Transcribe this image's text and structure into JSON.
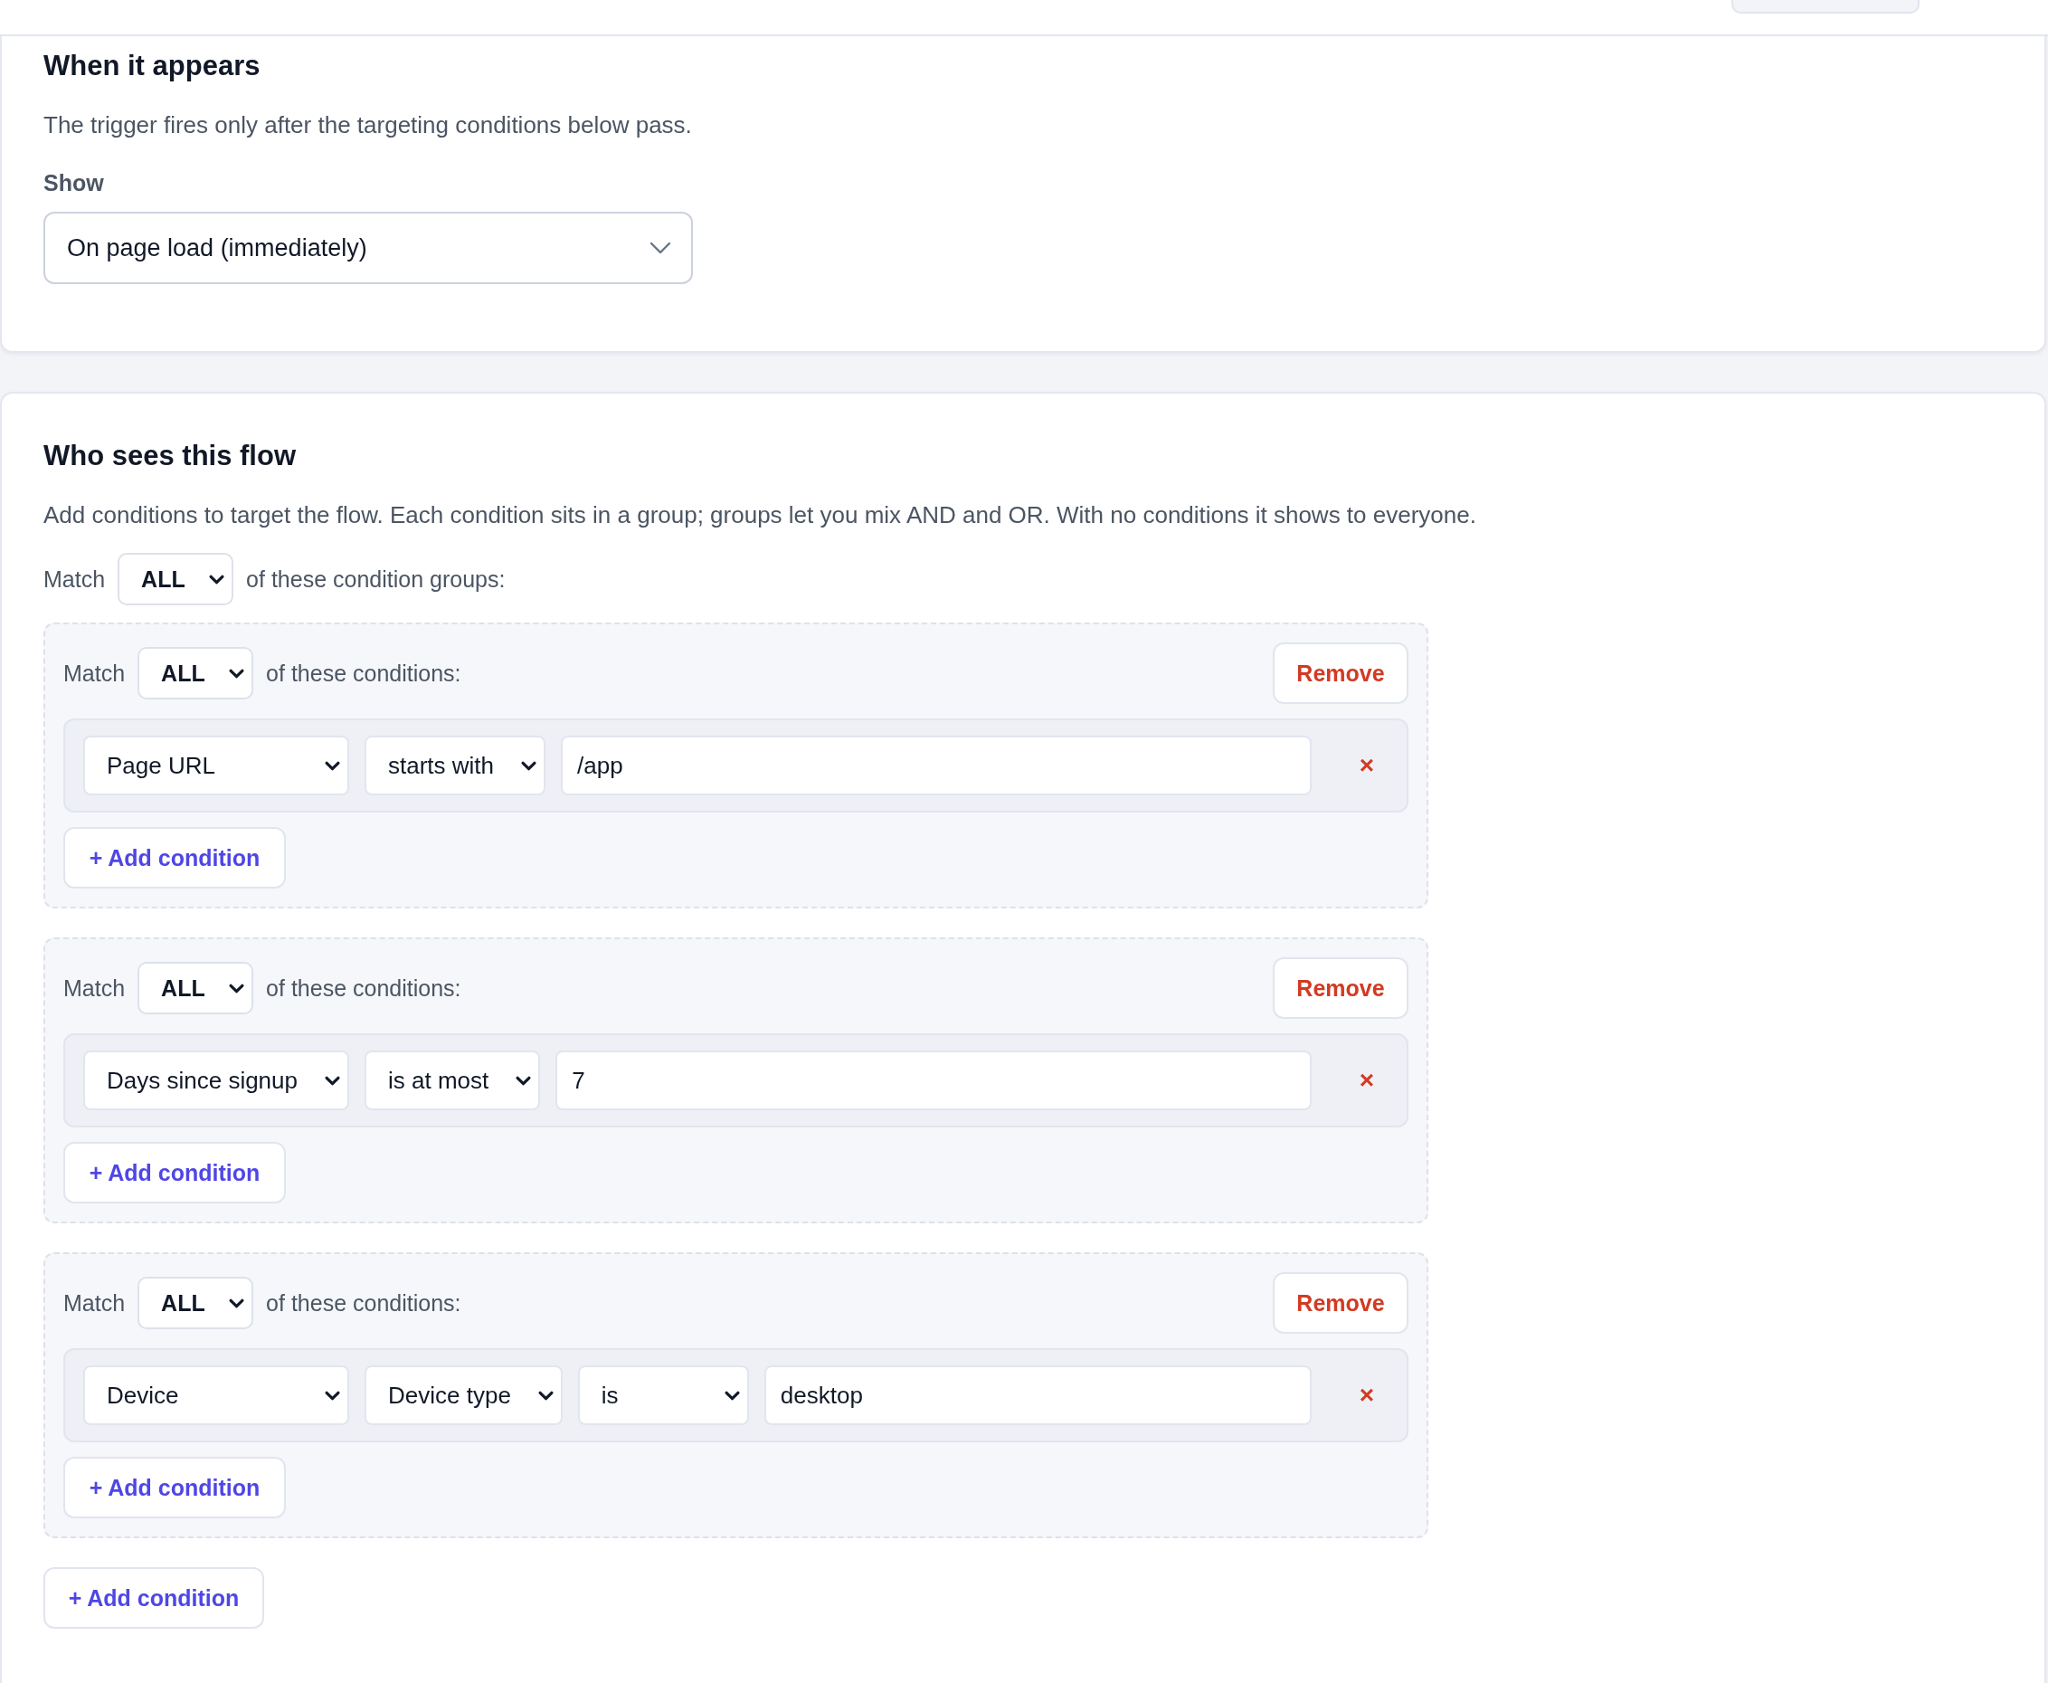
{
  "trigger": {
    "title": "When it appears",
    "description": "The trigger fires only after the targeting conditions below pass.",
    "show_label": "Show",
    "show_value": "On page load (immediately)"
  },
  "targeting": {
    "title": "Who sees this flow",
    "description": "Add conditions to target the flow. Each condition sits in a group; groups let you mix AND and OR. With no conditions it shows to everyone.",
    "match_label": "Match",
    "match_value": "ALL",
    "match_suffix": "of these condition groups:",
    "groups": [
      {
        "match_label": "Match",
        "match_value": "ALL",
        "match_suffix": "of these conditions:",
        "remove_label": "Remove",
        "conditions": [
          {
            "fields": [
              {
                "kind": "select",
                "value": "Page URL"
              },
              {
                "kind": "select",
                "value": "starts with"
              },
              {
                "kind": "input",
                "value": "/app"
              }
            ],
            "delete_icon": "×"
          }
        ],
        "add_label": "+ Add condition"
      },
      {
        "match_label": "Match",
        "match_value": "ALL",
        "match_suffix": "of these conditions:",
        "remove_label": "Remove",
        "conditions": [
          {
            "fields": [
              {
                "kind": "select",
                "value": "Days since signup"
              },
              {
                "kind": "select",
                "value": "is at most"
              },
              {
                "kind": "input",
                "value": "7"
              }
            ],
            "delete_icon": "×"
          }
        ],
        "add_label": "+ Add condition"
      },
      {
        "match_label": "Match",
        "match_value": "ALL",
        "match_suffix": "of these conditions:",
        "remove_label": "Remove",
        "conditions": [
          {
            "fields": [
              {
                "kind": "select",
                "value": "Device"
              },
              {
                "kind": "select",
                "value": "Device type"
              },
              {
                "kind": "select",
                "value": "is"
              },
              {
                "kind": "input",
                "value": "desktop"
              }
            ],
            "delete_icon": "×"
          }
        ],
        "add_label": "+ Add condition"
      }
    ],
    "add_label": "+ Add condition"
  }
}
